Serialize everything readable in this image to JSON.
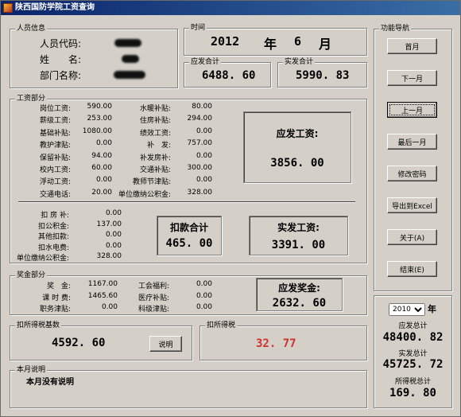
{
  "window": {
    "title": "陕西国防学院工资查询"
  },
  "person": {
    "legend": "人员信息",
    "code_label": "人员代码:",
    "name_label": "姓　　名:",
    "dept_label": "部门名称:"
  },
  "time": {
    "legend": "时间",
    "year": "2012",
    "year_unit": "年",
    "month": "6",
    "month_unit": "月"
  },
  "totals": {
    "payable_legend": "应发合计",
    "payable": "6488. 60",
    "actual_legend": "实发合计",
    "actual": "5990. 83"
  },
  "salary": {
    "legend": "工资部分",
    "col1": [
      {
        "label": "岗位工资:",
        "value": "590.00"
      },
      {
        "label": "薪级工资:",
        "value": "253.00"
      },
      {
        "label": "基础补贴:",
        "value": "1080.00"
      },
      {
        "label": "教护津贴:",
        "value": "0.00"
      },
      {
        "label": "保留补贴:",
        "value": "94.00"
      },
      {
        "label": "校内工资:",
        "value": "60.00"
      },
      {
        "label": "浮动工资:",
        "value": "0.00"
      },
      {
        "label": "交通电话:",
        "value": "20.00"
      }
    ],
    "col2": [
      {
        "label": "水暖补贴:",
        "value": "80.00"
      },
      {
        "label": "住房补贴:",
        "value": "294.00"
      },
      {
        "label": "绩效工资:",
        "value": "0.00"
      },
      {
        "label": "补　发:",
        "value": "757.00"
      },
      {
        "label": "补发房补:",
        "value": "0.00"
      },
      {
        "label": "交通补贴:",
        "value": "300.00"
      },
      {
        "label": "教师节津贴:",
        "value": "0.00"
      },
      {
        "label": "单位缴纳公积金:",
        "value": "328.00"
      }
    ],
    "payable_label": "应发工资:",
    "payable_value": "3856. 00",
    "deductions": [
      {
        "label": "扣 房 补:",
        "value": "0.00"
      },
      {
        "label": "扣公积金:",
        "value": "137.00"
      },
      {
        "label": "其他扣款:",
        "value": "0.00"
      },
      {
        "label": "扣水电费:",
        "value": "0.00"
      },
      {
        "label": "单位缴纳公积金:",
        "value": "328.00"
      }
    ],
    "deduct_total_label": "扣款合计",
    "deduct_total_value": "465. 00",
    "actual_label": "实发工资:",
    "actual_value": "3391. 00"
  },
  "bonus": {
    "legend": "奖金部分",
    "col1": [
      {
        "label": "奖　金:",
        "value": "1167.00"
      },
      {
        "label": "课 时 费:",
        "value": "1465.60"
      },
      {
        "label": "职务津贴:",
        "value": "0.00"
      }
    ],
    "col2": [
      {
        "label": "工会福利:",
        "value": "0.00"
      },
      {
        "label": "医疗补贴:",
        "value": "0.00"
      },
      {
        "label": "科级津贴:",
        "value": "0.00"
      }
    ],
    "total_label": "应发奖金:",
    "total_value": "2632. 60"
  },
  "tax_base": {
    "legend": "扣所得税基数",
    "value": "4592. 60",
    "explain_btn": "说明"
  },
  "tax": {
    "legend": "扣所得税",
    "value": "32. 77",
    "color": "#d03030"
  },
  "note": {
    "legend": "本月说明",
    "text": "本月没有说明"
  },
  "nav": {
    "legend": "功能导航",
    "buttons": [
      "首月",
      "下一月",
      "上一月",
      "最后一月",
      "修改密码",
      "导出到Excel",
      "关于(A)",
      "结束(E)"
    ]
  },
  "yearly": {
    "year": "2010",
    "year_unit": "年",
    "payable_label": "应发总计",
    "payable_value": "48400. 82",
    "actual_label": "实发总计",
    "actual_value": "45725. 72",
    "tax_label": "所得税总计",
    "tax_value": "169. 80"
  }
}
